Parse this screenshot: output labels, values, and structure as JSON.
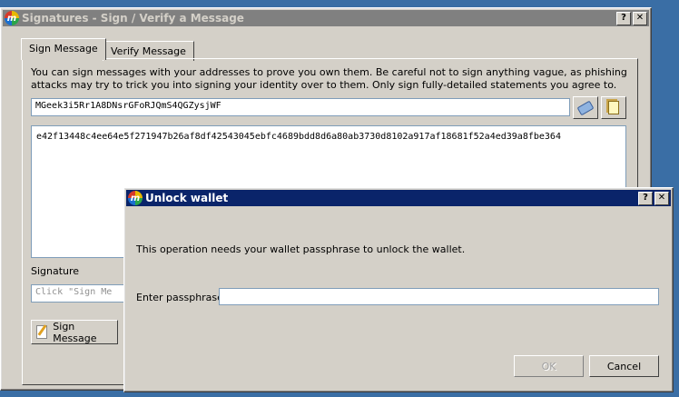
{
  "main_window": {
    "title": "Signatures - Sign / Verify a Message",
    "help_label": "?",
    "close_label": "✕",
    "tabs": [
      {
        "label": "Sign Message",
        "active": true
      },
      {
        "label": "Verify Message",
        "active": false
      }
    ],
    "sign": {
      "description": "You can sign messages with your addresses to prove you own them. Be careful not to sign anything vague, as phishing attacks may try to trick you into signing your identity over to them. Only sign fully-detailed statements you agree to.",
      "address_value": "MGeek3i5Rr1A8DNsrGFoRJQmS4QGZysjWF",
      "message_value": "e42f13448c4ee64e5f271947b26af8df42543045ebfc4689bdd8d6a80ab3730d8102a917af18681f52a4ed39a8fbe364",
      "signature_label": "Signature",
      "signature_placeholder": "Click \"Sign Me",
      "sign_button": "Sign Message"
    }
  },
  "unlock_dialog": {
    "title": "Unlock wallet",
    "help_label": "?",
    "close_label": "✕",
    "message": "This operation needs your wallet passphrase to unlock the wallet.",
    "passphrase_label": "Enter passphrase",
    "passphrase_value": "",
    "ok_button": "OK",
    "cancel_button": "Cancel"
  },
  "colors": {
    "desktop": "#3a6ea5",
    "active_title": "#0a246a",
    "inactive_title": "#808080"
  }
}
